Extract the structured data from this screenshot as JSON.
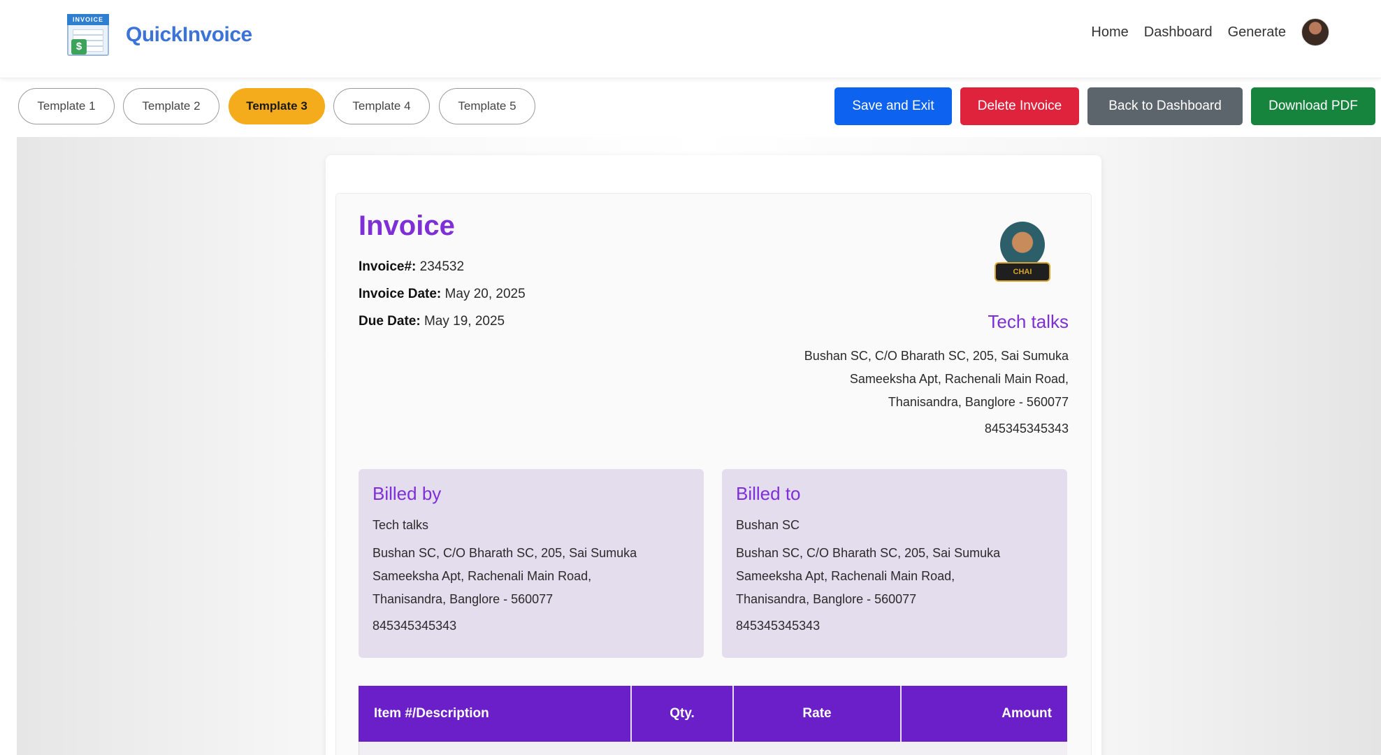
{
  "app": {
    "brand_name": "QuickInvoice",
    "brand_logo_band": "INVOICE",
    "brand_logo_symbol": "$",
    "nav": [
      "Home",
      "Dashboard",
      "Generate"
    ],
    "accent": "#3b73d9"
  },
  "toolbar": {
    "templates": [
      "Template 1",
      "Template 2",
      "Template 3",
      "Template 4",
      "Template 5"
    ],
    "active_template": "Template 3",
    "save_label": "Save and Exit",
    "delete_label": "Delete Invoice",
    "back_label": "Back to Dashboard",
    "download_label": "Download PDF",
    "colors": {
      "save": "#0d63f0",
      "delete": "#e0233c",
      "back": "#5c646c",
      "download": "#17843e",
      "active_template": "#f5ac1c"
    }
  },
  "invoice": {
    "title": "Invoice",
    "number_label": "Invoice#:",
    "number": "234532",
    "date_label": "Invoice Date:",
    "date": "May 20, 2025",
    "due_label": "Due Date:",
    "due": "May 19, 2025",
    "logo_badge": "CHAI",
    "company": {
      "name": "Tech talks",
      "address_lines": [
        "Bushan SC, C/O Bharath SC, 205, Sai Sumuka",
        "Sameeksha Apt, Rachenali Main Road,",
        "Thanisandra, Banglore - 560077"
      ],
      "phone": "845345345343"
    },
    "billed_by": {
      "heading": "Billed by",
      "name": "Tech talks",
      "address_lines": [
        "Bushan SC, C/O Bharath SC, 205, Sai Sumuka",
        "Sameeksha Apt, Rachenali Main Road,",
        "Thanisandra, Banglore - 560077"
      ],
      "phone": "845345345343"
    },
    "billed_to": {
      "heading": "Billed to",
      "name": "Bushan SC",
      "address_lines": [
        "Bushan SC, C/O Bharath SC, 205, Sai Sumuka",
        "Sameeksha Apt, Rachenali Main Road,",
        "Thanisandra, Banglore - 560077"
      ],
      "phone": "845345345343"
    },
    "table_headers": [
      "Item #/Description",
      "Qty.",
      "Rate",
      "Amount"
    ],
    "accent": "#7e2fd6",
    "table_header_color": "#6a1fc8",
    "bill_box_color": "#e4ddee"
  }
}
